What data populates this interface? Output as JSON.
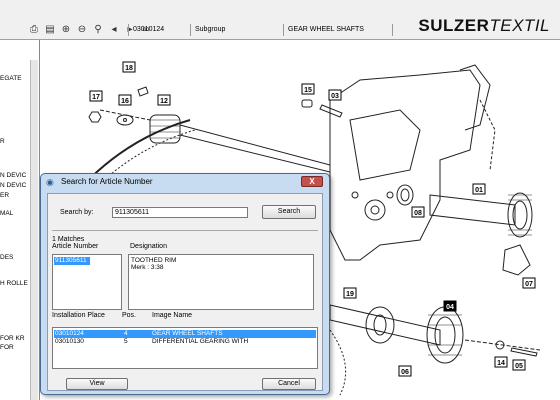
{
  "toolbar": {
    "icons": [
      "print-icon",
      "print-preview-icon",
      "zoom-in-icon",
      "zoom-out-icon",
      "search-icon",
      "previous-icon",
      "next-icon",
      "binoculars-icon"
    ],
    "article": "03010124",
    "subgroup_label": "Subgroup",
    "group_title": "GEAR WHEEL SHAFTS",
    "brand_bold": "SULZER",
    "brand_light": "TEXTIL"
  },
  "left_panel": {
    "items": [
      "EGATE",
      "R",
      "N DEVIC",
      "N DEVIC",
      "ER",
      "MAL",
      "DES",
      "H ROLLE",
      "FOR KR",
      "FOR"
    ]
  },
  "drawing": {
    "callouts": [
      "18",
      "17",
      "16",
      "12",
      "15",
      "03",
      "01",
      "08",
      "19",
      "04",
      "07",
      "14",
      "05",
      "06"
    ]
  },
  "dialog": {
    "title": "Search for Article Number",
    "close": "X",
    "search_label": "Search by:",
    "search_value": "911305611",
    "search_button": "Search",
    "matches": "1 Matches",
    "col_article": "Article Number",
    "col_designation": "Designation",
    "articles": [
      "911305611"
    ],
    "designation_lines": [
      "TOOTHED RIM",
      "Merk : 3:38"
    ],
    "col_install": "Installation Place",
    "col_pos": "Pos.",
    "col_image": "Image Name",
    "install_rows": [
      {
        "place": "03010124",
        "pos": "4",
        "image": "GEAR WHEEL SHAFTS"
      },
      {
        "place": "03010130",
        "pos": "5",
        "image": "DIFFERENTIAL GEARING WITH"
      }
    ],
    "view_button": "View",
    "cancel_button": "Cancel"
  }
}
